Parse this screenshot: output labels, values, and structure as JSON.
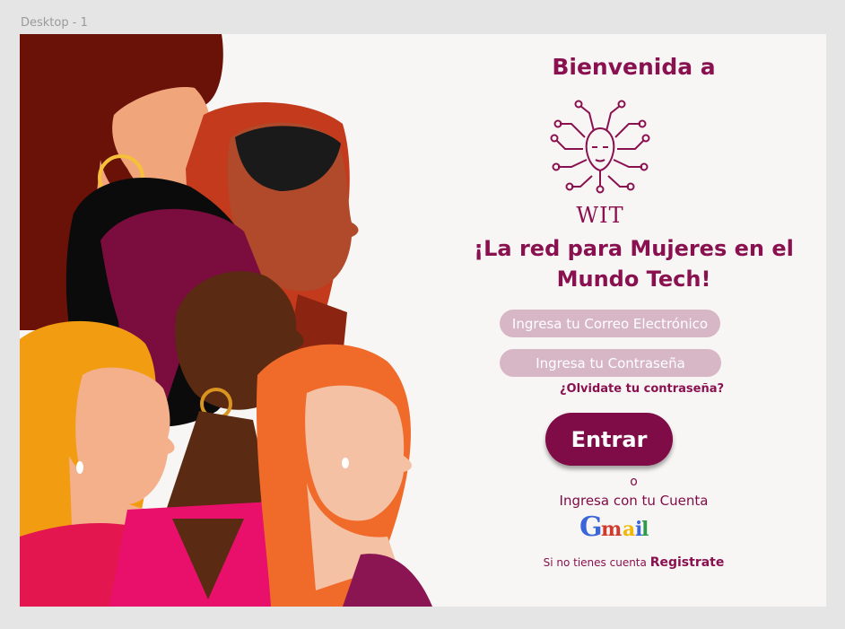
{
  "canvas": {
    "frame_label": "Desktop - 1"
  },
  "hero": {
    "welcome": "Bienvenida a",
    "logo_text": "WIT",
    "tagline_line1": "¡La red para Mujeres en el",
    "tagline_line2": "Mundo Tech!"
  },
  "form": {
    "email_placeholder": "Ingresa tu Correo Electrónico",
    "password_placeholder": "Ingresa tu Contraseña",
    "forgot_label": "¿Olvidate tu contraseña?",
    "submit_label": "Entrar"
  },
  "alt_login": {
    "or_label": "o",
    "prompt": "Ingresa con tu Cuenta",
    "provider_logo": "Gmail"
  },
  "signup": {
    "prefix": "Si no tienes cuenta",
    "link_label": "Registrate"
  },
  "colors": {
    "brand": "#8a1150",
    "button": "#7f0b47",
    "field_bg": "#d7b6c6",
    "page_bg": "#f8f6f4"
  }
}
